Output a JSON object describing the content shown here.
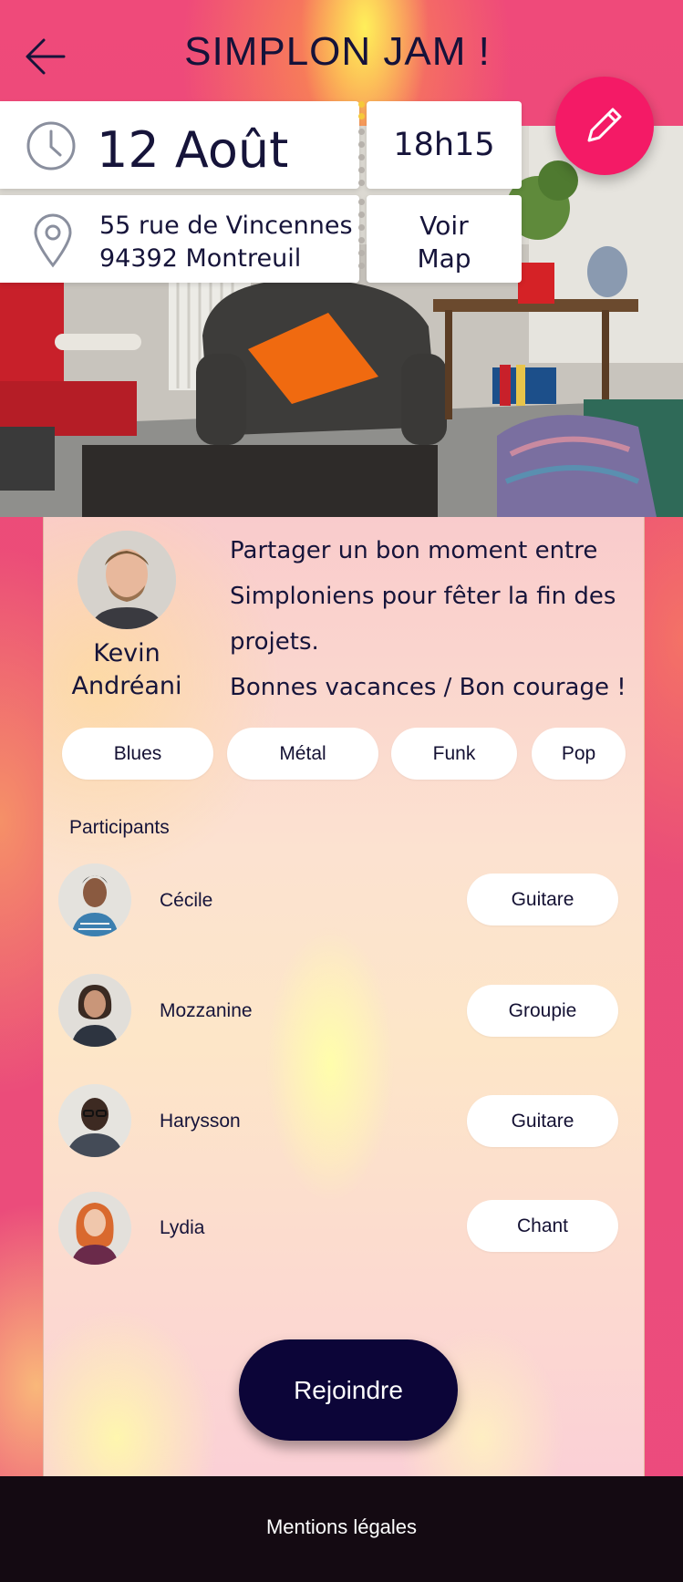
{
  "header": {
    "title": "SIMPLON JAM !"
  },
  "event": {
    "date": "12 Août",
    "time": "18h15",
    "address_line1": "55 rue de Vincennes",
    "address_line2": "94392 Montreuil",
    "map_line1": "Voir",
    "map_line2": "Map"
  },
  "host": {
    "first_name": "Kevin",
    "last_name": "Andréani"
  },
  "description": {
    "line1": "Partager un bon moment entre Simploniens pour fêter la fin des projets.",
    "line2": "Bonnes vacances / Bon courage !"
  },
  "genres": [
    "Blues",
    "Métal",
    "Funk",
    "Pop"
  ],
  "participants_label": "Participants",
  "participants": [
    {
      "name": "Cécile",
      "role": "Guitare"
    },
    {
      "name": "Mozzanine",
      "role": "Groupie"
    },
    {
      "name": "Harysson",
      "role": "Guitare"
    },
    {
      "name": "Lydia",
      "role": "Chant"
    }
  ],
  "join_label": "Rejoindre",
  "footer": {
    "legal_label": "Mentions légales"
  },
  "colors": {
    "accent": "#f41a66",
    "primary_dark": "#0c0538",
    "header_pink": "#ef4a7a",
    "footer_bg": "#140a12"
  },
  "icons": [
    "back-arrow-icon",
    "clock-icon",
    "location-pin-icon",
    "pencil-icon"
  ]
}
